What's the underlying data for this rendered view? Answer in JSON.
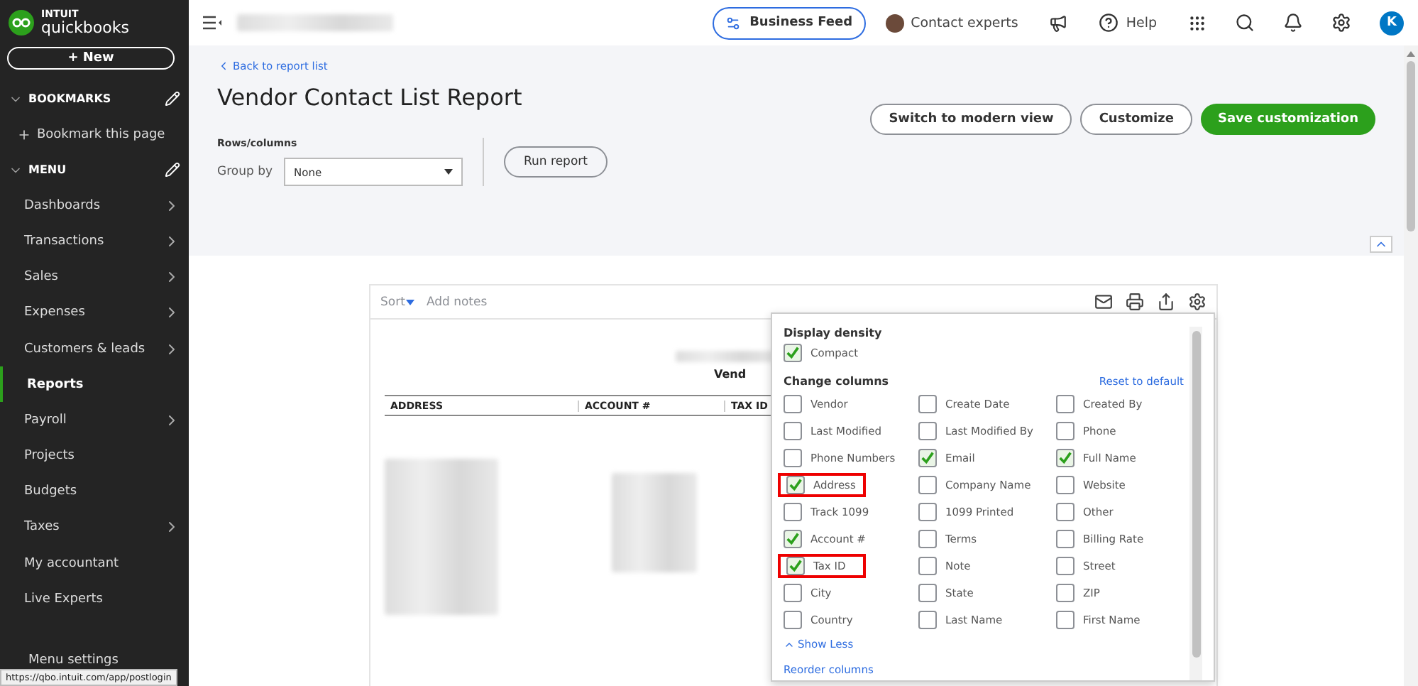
{
  "sidebar": {
    "logo_top": "INTUIT",
    "logo_bottom": "quickbooks",
    "new_button": "+ New",
    "sections": [
      {
        "title": "BOOKMARKS",
        "expanded": true,
        "items": [
          {
            "label": "Bookmark this page",
            "kind": "add",
            "has_submenu": false,
            "selected": false
          }
        ]
      },
      {
        "title": "MENU",
        "expanded": true,
        "items": [
          {
            "label": "Dashboards",
            "kind": "link",
            "has_submenu": true,
            "selected": false
          },
          {
            "label": "Transactions",
            "kind": "link",
            "has_submenu": true,
            "selected": false
          },
          {
            "label": "Sales",
            "kind": "link",
            "has_submenu": true,
            "selected": false
          },
          {
            "label": "Expenses",
            "kind": "link",
            "has_submenu": true,
            "selected": false
          },
          {
            "label": "Customers & leads",
            "kind": "link",
            "has_submenu": true,
            "selected": false
          },
          {
            "label": "Reports",
            "kind": "link",
            "has_submenu": false,
            "selected": true
          },
          {
            "label": "Payroll",
            "kind": "link",
            "has_submenu": true,
            "selected": false
          },
          {
            "label": "Projects",
            "kind": "link",
            "has_submenu": false,
            "selected": false
          },
          {
            "label": "Budgets",
            "kind": "link",
            "has_submenu": false,
            "selected": false
          },
          {
            "label": "Taxes",
            "kind": "link",
            "has_submenu": true,
            "selected": false
          },
          {
            "label": "My accountant",
            "kind": "link",
            "has_submenu": false,
            "selected": false
          },
          {
            "label": "Live Experts",
            "kind": "link",
            "has_submenu": false,
            "selected": false
          }
        ]
      }
    ],
    "footer": "Menu settings",
    "status_url": "https://qbo.intuit.com/app/postlogin"
  },
  "topbar": {
    "business_feed": "Business Feed",
    "contact": "Contact experts",
    "help": "Help",
    "avatar": "K"
  },
  "header": {
    "back_link": "Back to report list",
    "title": "Vendor Contact List Report",
    "buttons": [
      {
        "label": "Switch to modern view",
        "kind": "outline"
      },
      {
        "label": "Customize",
        "kind": "outline"
      },
      {
        "label": "Save customization",
        "kind": "primary"
      }
    ],
    "rows_columns_label": "Rows/columns",
    "group_by_label": "Group by",
    "group_by_value": "None",
    "run_button": "Run report"
  },
  "report": {
    "sort": "Sort",
    "add_notes": "Add notes",
    "subtitle": "Vend",
    "columns": [
      "ADDRESS",
      "ACCOUNT #",
      "TAX ID"
    ]
  },
  "popover": {
    "density_title": "Display density",
    "density": [
      {
        "label": "Compact",
        "checked": true
      }
    ],
    "columns_title": "Change columns",
    "reset": "Reset to default",
    "columns": [
      {
        "label": "Vendor",
        "checked": false,
        "highlighted": false
      },
      {
        "label": "Create Date",
        "checked": false,
        "highlighted": false
      },
      {
        "label": "Created By",
        "checked": false,
        "highlighted": false
      },
      {
        "label": "Last Modified",
        "checked": false,
        "highlighted": false
      },
      {
        "label": "Last Modified By",
        "checked": false,
        "highlighted": false
      },
      {
        "label": "Phone",
        "checked": false,
        "highlighted": false
      },
      {
        "label": "Phone Numbers",
        "checked": false,
        "highlighted": false
      },
      {
        "label": "Email",
        "checked": true,
        "highlighted": false
      },
      {
        "label": "Full Name",
        "checked": true,
        "highlighted": false
      },
      {
        "label": "Address",
        "checked": true,
        "highlighted": true
      },
      {
        "label": "Company Name",
        "checked": false,
        "highlighted": false
      },
      {
        "label": "Website",
        "checked": false,
        "highlighted": false
      },
      {
        "label": "Track 1099",
        "checked": false,
        "highlighted": false
      },
      {
        "label": "1099 Printed",
        "checked": false,
        "highlighted": false
      },
      {
        "label": "Other",
        "checked": false,
        "highlighted": false
      },
      {
        "label": "Account #",
        "checked": true,
        "highlighted": false
      },
      {
        "label": "Terms",
        "checked": false,
        "highlighted": false
      },
      {
        "label": "Billing Rate",
        "checked": false,
        "highlighted": false
      },
      {
        "label": "Tax ID",
        "checked": true,
        "highlighted": true
      },
      {
        "label": "Note",
        "checked": false,
        "highlighted": false
      },
      {
        "label": "Street",
        "checked": false,
        "highlighted": false
      },
      {
        "label": "City",
        "checked": false,
        "highlighted": false
      },
      {
        "label": "State",
        "checked": false,
        "highlighted": false
      },
      {
        "label": "ZIP",
        "checked": false,
        "highlighted": false
      },
      {
        "label": "Country",
        "checked": false,
        "highlighted": false
      },
      {
        "label": "Last Name",
        "checked": false,
        "highlighted": false
      },
      {
        "label": "First Name",
        "checked": false,
        "highlighted": false
      }
    ],
    "show_less": "Show Less",
    "reorder": "Reorder columns"
  }
}
